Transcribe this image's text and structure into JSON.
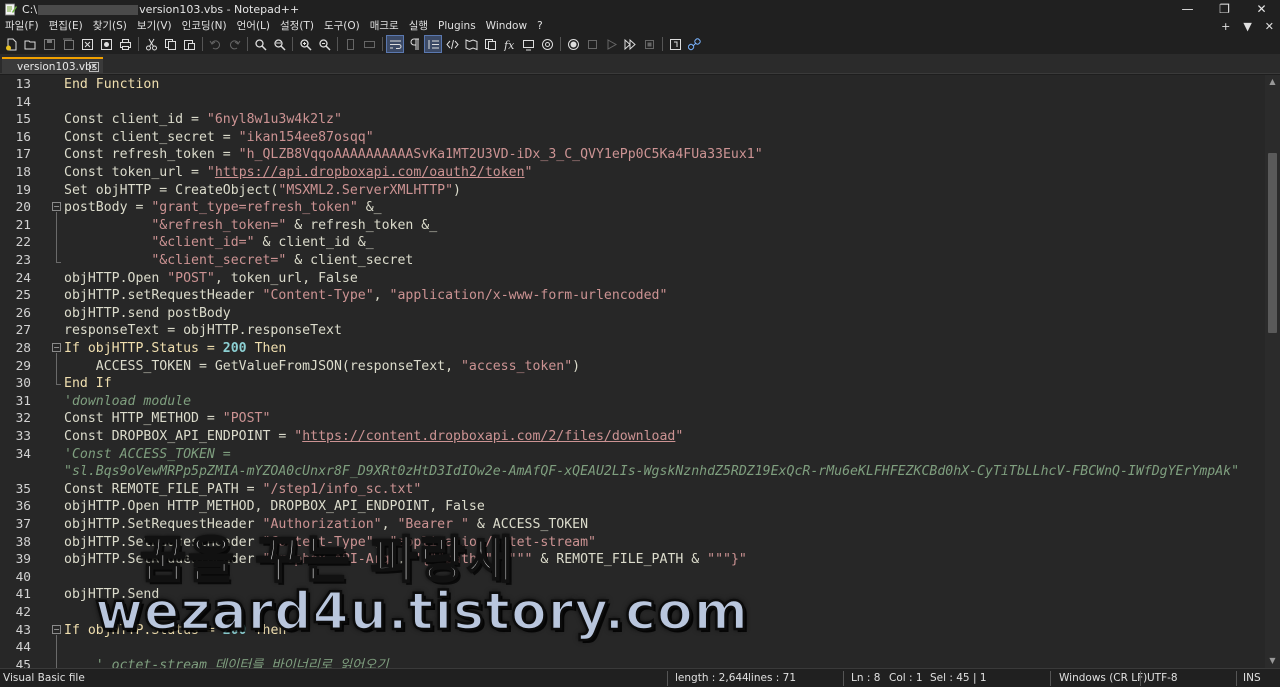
{
  "window": {
    "title_prefix": "C:\\",
    "title_suffix": "version103.vbs - Notepad++",
    "minimize": "—",
    "restore": "❐",
    "close": "✕"
  },
  "menu": {
    "items": [
      "파일(F)",
      "편집(E)",
      "찾기(S)",
      "보기(V)",
      "인코딩(N)",
      "언어(L)",
      "설정(T)",
      "도구(O)",
      "매크로",
      "실행",
      "Plugins",
      "Window",
      "?"
    ],
    "right": [
      "+",
      "▼",
      "✕"
    ]
  },
  "tab": {
    "label": "version103.vbs",
    "close": "✕"
  },
  "editor": {
    "lines": [
      {
        "n": "13",
        "html_key": "l13"
      },
      {
        "n": "14",
        "html_key": "l14"
      },
      {
        "n": "15",
        "html_key": "l15"
      },
      {
        "n": "16",
        "html_key": "l16"
      },
      {
        "n": "17",
        "html_key": "l17"
      },
      {
        "n": "18",
        "html_key": "l18"
      },
      {
        "n": "19",
        "html_key": "l19"
      },
      {
        "n": "20",
        "html_key": "l20"
      },
      {
        "n": "21",
        "html_key": "l21"
      },
      {
        "n": "22",
        "html_key": "l22"
      },
      {
        "n": "23",
        "html_key": "l23"
      },
      {
        "n": "24",
        "html_key": "l24"
      },
      {
        "n": "25",
        "html_key": "l25"
      },
      {
        "n": "26",
        "html_key": "l26"
      },
      {
        "n": "27",
        "html_key": "l27"
      },
      {
        "n": "28",
        "html_key": "l28"
      },
      {
        "n": "29",
        "html_key": "l29"
      },
      {
        "n": "30",
        "html_key": "l30"
      },
      {
        "n": "31",
        "html_key": "l31"
      },
      {
        "n": "32",
        "html_key": "l32"
      },
      {
        "n": "33",
        "html_key": "l33"
      },
      {
        "n": "34",
        "html_key": "l34"
      },
      {
        "n": "",
        "html_key": "l34b"
      },
      {
        "n": "35",
        "html_key": "l35"
      },
      {
        "n": "36",
        "html_key": "l36"
      },
      {
        "n": "37",
        "html_key": "l37"
      },
      {
        "n": "38",
        "html_key": "l38"
      },
      {
        "n": "39",
        "html_key": "l39"
      },
      {
        "n": "40",
        "html_key": "l40"
      },
      {
        "n": "41",
        "html_key": "l41"
      },
      {
        "n": "42",
        "html_key": "l42"
      },
      {
        "n": "43",
        "html_key": "l43"
      },
      {
        "n": "44",
        "html_key": "l44"
      },
      {
        "n": "45",
        "html_key": "l45"
      }
    ],
    "code": {
      "l13_kw": "End Function",
      "l15_a": "Const client_id = ",
      "l15_s": "\"6nyl8w1u3w4k2lz\"",
      "l16_a": "Const client_secret = ",
      "l16_s": "\"ikan154ee87osqq\"",
      "l17_a": "Const refresh_token = ",
      "l17_s": "\"h_QLZB8VqqoAAAAAAAAAASvKa1MT2U3VD-iDx_3_C_QVY1ePp0C5Ka4FUa33Eux1\"",
      "l18_a": "Const token_url = ",
      "l18_q1": "\"",
      "l18_u": "https://api.dropboxapi.com/oauth2/token",
      "l18_q2": "\"",
      "l19_a": "Set objHTTP = CreateObject(",
      "l19_s": "\"MSXML2.ServerXMLHTTP\"",
      "l19_b": ")",
      "l20_a": "postBody = ",
      "l20_s": "\"grant_type=refresh_token\"",
      "l20_b": " &_",
      "l21_pad": "           ",
      "l21_s": "\"&refresh_token=\"",
      "l21_b": " & refresh_token &_",
      "l22_pad": "           ",
      "l22_s": "\"&client_id=\"",
      "l22_b": " & client_id &_",
      "l23_pad": "           ",
      "l23_s": "\"&client_secret=\"",
      "l23_b": " & client_secret",
      "l24_a": "objHTTP.Open ",
      "l24_s": "\"POST\"",
      "l24_b": ", token_url, False",
      "l25_a": "objHTTP.setRequestHeader ",
      "l25_s1": "\"Content-Type\"",
      "l25_b": ", ",
      "l25_s2": "\"application/x-www-form-urlencoded\"",
      "l26_a": "objHTTP.send postBody",
      "l27_a": "responseText = objHTTP.responseText",
      "l28_a": "If objHTTP.Status = ",
      "l28_n": "200",
      "l28_b": " Then",
      "l29_a": "    ACCESS_TOKEN = GetValueFromJSON(responseText, ",
      "l29_s": "\"access_token\"",
      "l29_b": ")",
      "l30_a": "End If",
      "l31_c": "'download module",
      "l32_a": "Const HTTP_METHOD = ",
      "l32_s": "\"POST\"",
      "l33_a": "Const DROPBOX_API_ENDPOINT = ",
      "l33_q1": "\"",
      "l33_u": "https://content.dropboxapi.com/2/files/download",
      "l33_q2": "\"",
      "l34_c": "'Const ACCESS_TOKEN =",
      "l34b_c": "\"sl.Bqs9oVewMRPp5pZMIA-mYZOA0cUnxr8F_D9XRt0zHtD3IdIOw2e-AmAfQF-xQEAU2LIs-WgskNznhdZ5RDZ19ExQcR-rMu6eKLFHFEZKCBd0hX-CyTiTbLLhcV-FBCWnQ-IWfDgYErYmpAk\"",
      "l35_a": "Const REMOTE_FILE_PATH = ",
      "l35_s": "\"/step1/info_sc.txt\"",
      "l36_a": "objHTTP.Open HTTP_METHOD, DROPBOX_API_ENDPOINT, False",
      "l37_a": "objHTTP.SetRequestHeader ",
      "l37_s1": "\"Authorization\"",
      "l37_b": ", ",
      "l37_s2": "\"Bearer \"",
      "l37_c": " & ACCESS_TOKEN",
      "l38_a": "objHTTP.SetRequestHeader ",
      "l38_s1": "\"Content-Type\"",
      "l38_b": ", ",
      "l38_s2": "\"application/octet-stream\"",
      "l39_a": "objHTTP.SetRequestHeader ",
      "l39_s1": "\"Dropbox-API-Arg\"",
      "l39_b": ", ",
      "l39_s2": "\"{\"\"path\"\": \"\"\"",
      "l39_c": " & REMOTE_FILE_PATH & ",
      "l39_s3": "\"\"\"}\"",
      "l41_a": "objHTTP.Send",
      "l43_a": "If objHTTP.Status = ",
      "l43_n": "200",
      "l43_b": " Then",
      "l45_c": "    ' octet-stream 데이터를 바이너리로 읽어오기"
    }
  },
  "statusbar": {
    "language": "Visual Basic file",
    "length": "length : 2,644",
    "lines": "lines : 71",
    "ln": "Ln : 8",
    "col": "Col : 1",
    "sel": "Sel : 45 | 1",
    "eol": "Windows (CR LF)",
    "encoding": "UTF-8",
    "mode": "INS"
  },
  "watermark": {
    "korean": "꿈을 꾸는 파랑새",
    "url": "wezard4u.tistory.com"
  },
  "colors": {
    "keyword": "#f0dfaf",
    "string": "#cc9393",
    "comment": "#7f9f7f",
    "number": "#8cd0d3",
    "tab_accent": "#f2a100"
  }
}
